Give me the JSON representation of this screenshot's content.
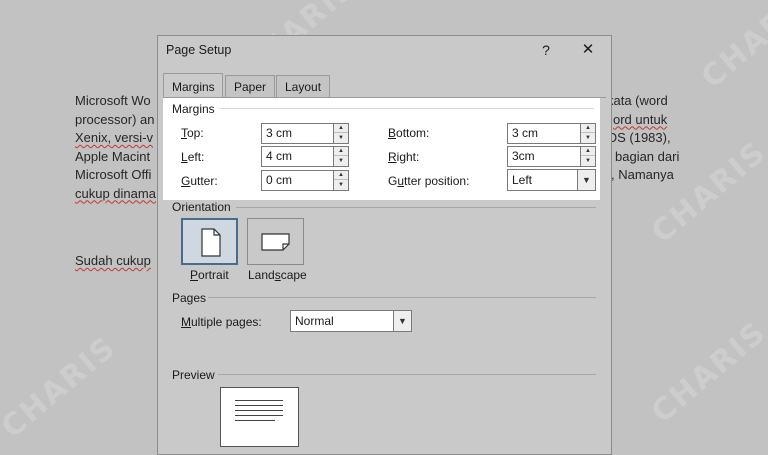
{
  "document": {
    "p1_lines": [
      "Microsoft Wo",
      "processor) an",
      "Xenix, versi-v",
      "Apple Macint",
      "Microsoft Offi",
      "cukup dinama"
    ],
    "p1_right_lines": [
      "kata (word",
      "ord untuk",
      "OS (1983),",
      "bagian dari",
      ", Namanya",
      ""
    ],
    "p2_line": "Sudah cukup"
  },
  "dialog": {
    "title": "Page Setup",
    "help": "?",
    "close": "✕",
    "tabs": [
      "Margins",
      "Paper",
      "Layout"
    ],
    "margins_section": "Margins",
    "top": {
      "label_u": "T",
      "label_rest": "op:",
      "value": "3 cm"
    },
    "left": {
      "label_u": "L",
      "label_rest": "eft:",
      "value": "4 cm"
    },
    "gutter": {
      "label_u": "G",
      "label_rest": "utter:",
      "value": "0 cm"
    },
    "bottom": {
      "label_u": "B",
      "label_rest": "ottom:",
      "value": "3 cm"
    },
    "right": {
      "label_u": "R",
      "label_rest": "ight:",
      "value": "3cm"
    },
    "gutter_position": {
      "label_pre": "G",
      "label_u": "u",
      "label_rest": "tter position:",
      "value": "Left"
    },
    "orientation_section": "Orientation",
    "portrait": {
      "label_u": "P",
      "label_rest": "ortrait"
    },
    "landscape": {
      "label_pre": "Land",
      "label_u": "s",
      "label_rest": "cape"
    },
    "pages_section": "Pages",
    "multiple_pages": {
      "label_u": "M",
      "label_rest": "ultiple pages:",
      "value": "Normal"
    },
    "preview_section": "Preview"
  },
  "watermark": "CHARIS"
}
